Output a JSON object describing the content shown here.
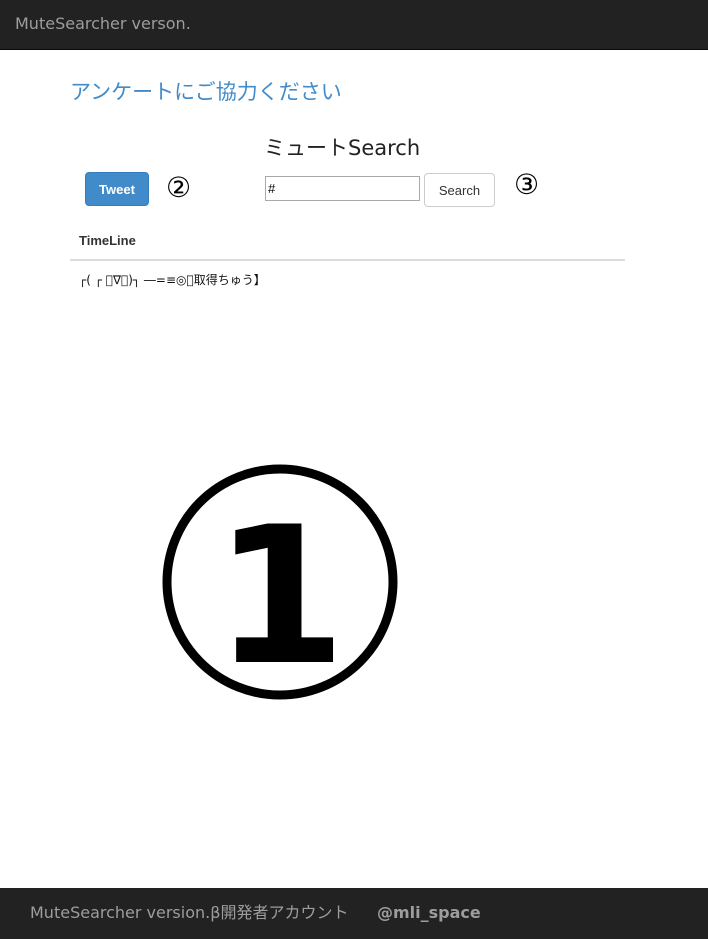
{
  "navbar": {
    "brand": "MuteSearcher verson."
  },
  "survey": {
    "link_text": "アンケートにご協力ください"
  },
  "tweet": {
    "button_label": "Tweet"
  },
  "markers": {
    "two": "②",
    "three": "③",
    "one": "1"
  },
  "search": {
    "title": "ミュートSearch",
    "input_value": "#",
    "button_label": "Search"
  },
  "timeline": {
    "header": "TimeLine",
    "status_text": "┌( ┌ ﾟ∇ﾟ)┐ ―=≡◎【取得ちゅう】"
  },
  "footer": {
    "version_text": "MuteSearcher version.β開発者アカウント",
    "account_link": "@mli_space"
  },
  "colors": {
    "navbar_bg": "#222222",
    "link_blue": "#428bca",
    "primary_button": "#428bca"
  }
}
